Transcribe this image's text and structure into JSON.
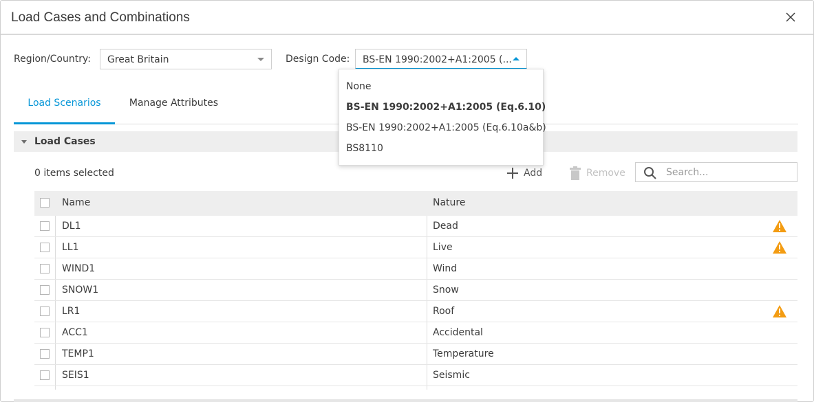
{
  "dialog": {
    "title": "Load Cases and Combinations"
  },
  "filters": {
    "region_label": "Region/Country:",
    "region_value": "Great Britain",
    "design_code_label": "Design Code:",
    "design_code_value": "BS-EN 1990:2002+A1:2005 (..."
  },
  "dropdown": {
    "options": [
      {
        "label": "None",
        "selected": false
      },
      {
        "label": "BS-EN 1990:2002+A1:2005 (Eq.6.10)",
        "selected": true
      },
      {
        "label": "BS-EN 1990:2002+A1:2005 (Eq.6.10a&b)",
        "selected": false
      },
      {
        "label": "BS8110",
        "selected": false
      }
    ]
  },
  "tabs": [
    {
      "label": "Load Scenarios",
      "active": true
    },
    {
      "label": "Manage Attributes",
      "active": false
    }
  ],
  "section": {
    "title": "Load Cases"
  },
  "toolbar": {
    "selection_status": "0 items selected",
    "add_label": "Add",
    "remove_label": "Remove",
    "search_placeholder": "Search..."
  },
  "table": {
    "columns": [
      "Name",
      "Nature"
    ],
    "rows": [
      {
        "name": "DL1",
        "nature": "Dead",
        "warning": true
      },
      {
        "name": "LL1",
        "nature": "Live",
        "warning": true
      },
      {
        "name": "WIND1",
        "nature": "Wind",
        "warning": false
      },
      {
        "name": "SNOW1",
        "nature": "Snow",
        "warning": false
      },
      {
        "name": "LR1",
        "nature": "Roof",
        "warning": true
      },
      {
        "name": "ACC1",
        "nature": "Accidental",
        "warning": false
      },
      {
        "name": "TEMP1",
        "nature": "Temperature",
        "warning": false
      },
      {
        "name": "SEIS1",
        "nature": "Seismic",
        "warning": false
      }
    ]
  },
  "colors": {
    "accent": "#0696d7",
    "warning": "#f39c12",
    "header_bg": "#eeeeee"
  },
  "icons": {
    "close": "close-icon",
    "add": "plus-icon",
    "remove": "trash-icon",
    "search": "search-icon",
    "warning": "warning-icon"
  }
}
